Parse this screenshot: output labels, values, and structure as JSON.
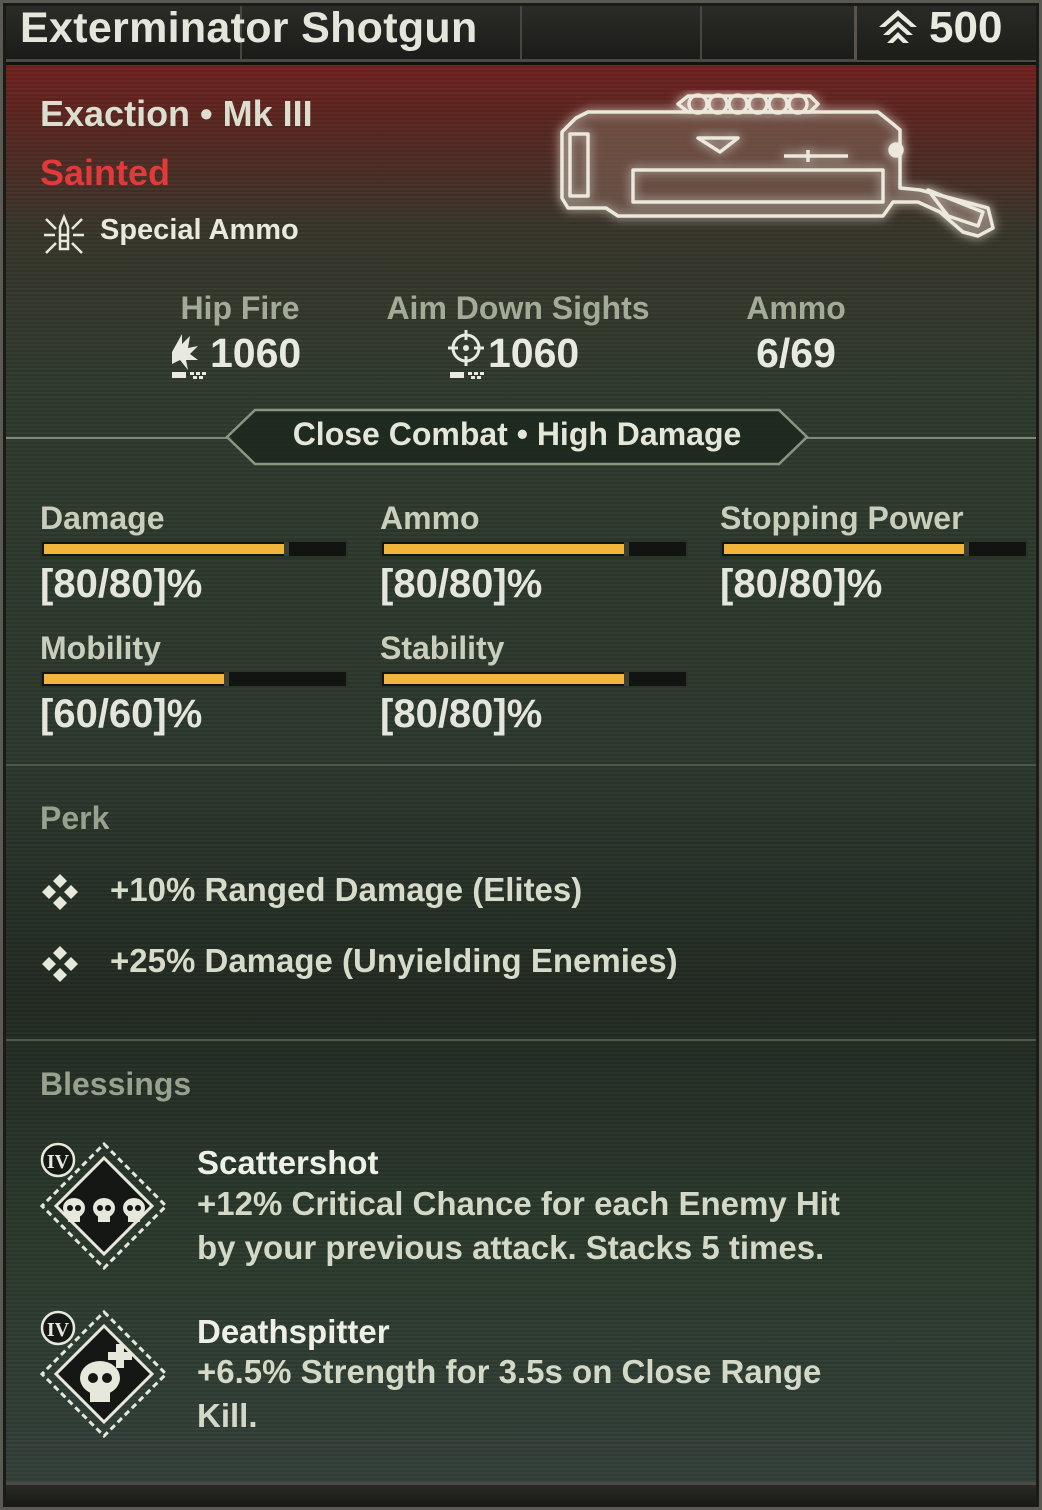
{
  "header": {
    "title": "Exterminator Shotgun",
    "rating": "500",
    "rating_icon": "chevron-rank-icon"
  },
  "weapon": {
    "subtitle": "Exaction • Mk III",
    "rarity": "Sainted",
    "special_label": "Special Ammo",
    "special_icon": "special-ammo-icon",
    "rarity_color": "#e23a3a"
  },
  "top_stats": [
    {
      "label": "Hip Fire",
      "value": "1060",
      "icon": "hip-fire-icon"
    },
    {
      "label": "Aim Down Sights",
      "value": "1060",
      "icon": "crosshair-icon"
    },
    {
      "label": "Ammo",
      "value": "6/69"
    }
  ],
  "tags": "Close Combat • High Damage",
  "stats": [
    {
      "name": "Damage",
      "value": "[80/80]%",
      "fill": 0.8
    },
    {
      "name": "Ammo",
      "value": "[80/80]%",
      "fill": 0.8
    },
    {
      "name": "Stopping Power",
      "value": "[80/80]%",
      "fill": 0.8
    },
    {
      "name": "Mobility",
      "value": "[60/60]%",
      "fill": 0.6
    },
    {
      "name": "Stability",
      "value": "[80/80]%",
      "fill": 0.8
    }
  ],
  "bar_color": "#f2b53c",
  "perk": {
    "title": "Perk",
    "items": [
      {
        "text": "+10% Ranged Damage (Elites)",
        "icon": "diamond-cluster-icon"
      },
      {
        "text": "+25% Damage (Unyielding Enemies)",
        "icon": "diamond-cluster-icon"
      }
    ]
  },
  "blessings": {
    "title": "Blessings",
    "items": [
      {
        "tier": "IV",
        "name": "Scattershot",
        "desc": "+12% Critical Chance for each Enemy Hit by your previous attack. Stacks 5 times.",
        "icon": "three-skulls-icon"
      },
      {
        "tier": "IV",
        "name": "Deathspitter",
        "desc": "+6.5% Strength for 3.5s on Close Range Kill.",
        "icon": "skull-plus-icon"
      }
    ]
  }
}
